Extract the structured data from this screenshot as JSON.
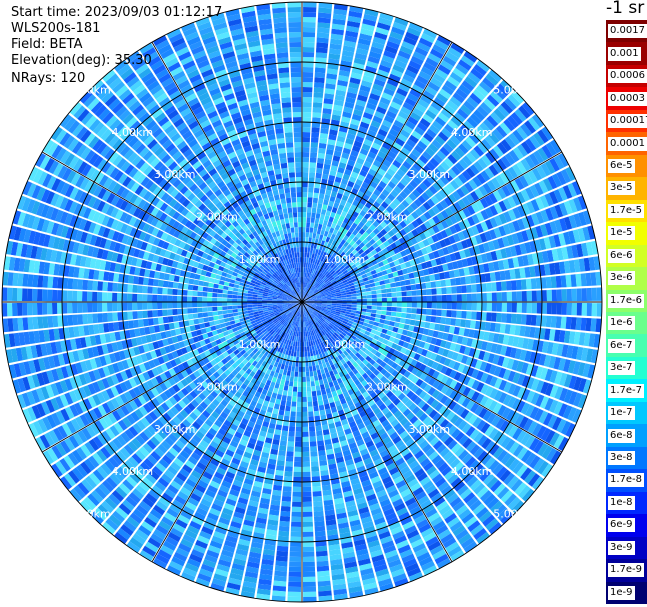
{
  "info": {
    "start_time": "Start time: 2023/09/03 01:12:17",
    "instrument": "WLS200s-181",
    "field": "Field: BETA",
    "elevation": "Elevation(deg): 35.30",
    "nrays": "NRays: 120"
  },
  "colorbar": {
    "unit_label": "-1 sr",
    "labels": [
      "0.0017",
      "0.001",
      "0.0006",
      "0.0003",
      "0.00017",
      "0.0001",
      "6e-5",
      "3e-5",
      "1.7e-5",
      "1e-5",
      "6e-6",
      "3e-6",
      "1.7e-6",
      "1e-6",
      "6e-7",
      "3e-7",
      "1.7e-7",
      "1e-7",
      "6e-8",
      "3e-8",
      "1.7e-8",
      "1e-8",
      "6e-9",
      "3e-9",
      "1.7e-9",
      "1e-9"
    ],
    "colors": [
      "#7f0000",
      "#9a0000",
      "#c40000",
      "#ee0000",
      "#ff3000",
      "#ff6400",
      "#ff9000",
      "#ffb400",
      "#ffe000",
      "#f2ff00",
      "#d2ff24",
      "#b0ff48",
      "#8cff6a",
      "#6aff8c",
      "#48ffb0",
      "#24ffd2",
      "#00f0ff",
      "#00c8ff",
      "#00a0ff",
      "#0078ff",
      "#0050ff",
      "#0028ff",
      "#0000ee",
      "#0000c4",
      "#00009a",
      "#000070"
    ]
  },
  "chart_data": {
    "type": "ppi-polar",
    "title": "",
    "field": "BETA",
    "elevation_deg": 35.3,
    "nrays": 120,
    "range_rings_km": [
      1,
      2,
      3,
      4,
      5
    ],
    "ring_labels": [
      "1.00km",
      "2.00km",
      "3.00km",
      "4.00km",
      "5.00km"
    ],
    "max_range_km": 5.0,
    "spokes_deg": [
      0,
      30,
      60,
      90,
      120,
      150,
      180,
      210,
      240,
      270,
      300,
      330
    ],
    "dominant_value_range": [
      "1e-8",
      "3e-7"
    ],
    "near_center_value_range": [
      "1e-8",
      "3e-8"
    ]
  }
}
